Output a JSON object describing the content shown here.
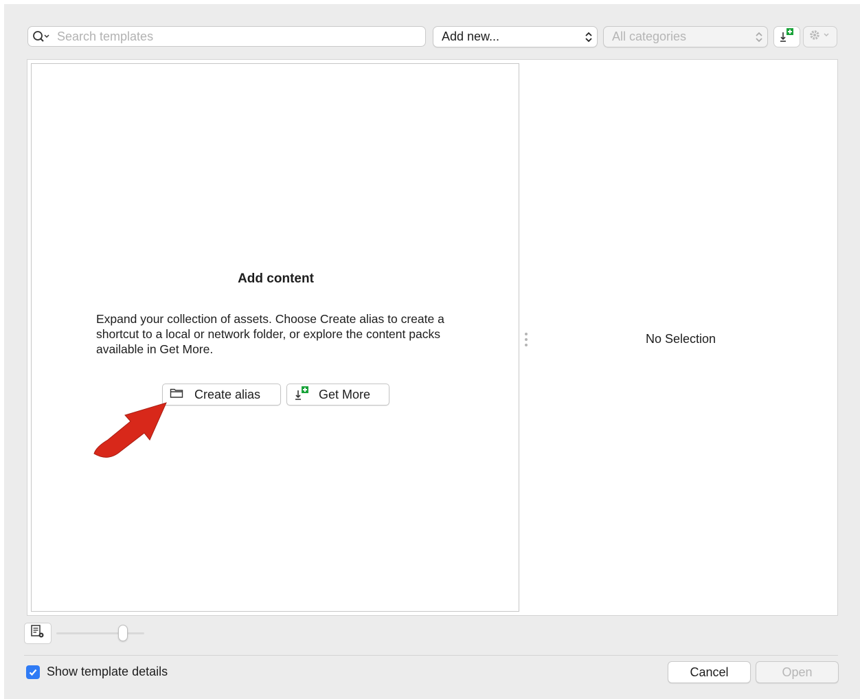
{
  "toolbar": {
    "search_placeholder": "Search templates",
    "search_icon": "magnifier-dropdown-icon",
    "add_new_label": "Add new...",
    "categories_label": "All categories",
    "get_more_icon": "download-plus-icon",
    "gear_icon": "gear-icon"
  },
  "left_panel": {
    "title": "Add content",
    "description": "Expand your collection of assets. Choose Create alias to create a shortcut to a local or network folder, or explore the content packs available in Get More.",
    "create_alias_label": "Create alias",
    "create_alias_icon": "folder-icon",
    "get_more_label": "Get More",
    "get_more_icon": "download-plus-icon",
    "annotation": "red-arrow"
  },
  "right_panel": {
    "empty_text": "No Selection"
  },
  "bottom": {
    "view_icon": "template-view-options-icon",
    "zoom_fraction": 0.76,
    "show_details_label": "Show template details",
    "show_details_checked": true,
    "cancel_label": "Cancel",
    "open_label": "Open"
  },
  "colors": {
    "accent": "#2f7bf5",
    "annotation_arrow": "#d8281a",
    "get_more_plus": "#1aa33a"
  }
}
